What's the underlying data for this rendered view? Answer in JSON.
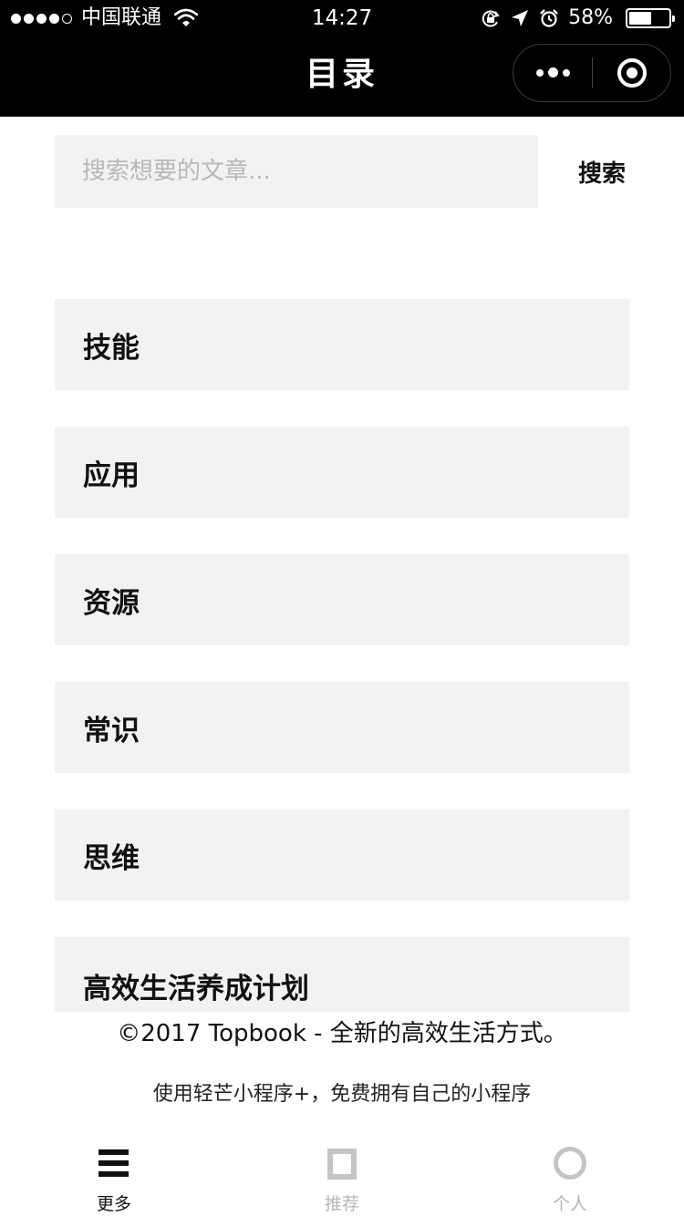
{
  "status_bar": {
    "carrier": "中国联通",
    "time": "14:27",
    "battery": "58%",
    "battery_level": 0.58,
    "icons": [
      "signal-dots-icon",
      "wifi-icon",
      "rotation-lock-icon",
      "location-arrow-icon",
      "alarm-icon",
      "battery-icon"
    ]
  },
  "nav": {
    "title": "目录",
    "capsule_icons": [
      "more-dots-icon",
      "close-target-icon"
    ]
  },
  "search": {
    "placeholder": "搜索想要的文章...",
    "value": "",
    "button_label": "搜索"
  },
  "categories": [
    {
      "label": "技能"
    },
    {
      "label": "应用"
    },
    {
      "label": "资源"
    },
    {
      "label": "常识"
    },
    {
      "label": "思维"
    },
    {
      "label": "高效生活养成计划"
    }
  ],
  "footer": {
    "copyright": "©2017 Topbook - 全新的高效生活方式。",
    "promo": "使用轻芒小程序+，免费拥有自己的小程序"
  },
  "tabbar": {
    "tabs": [
      {
        "label": "更多",
        "icon": "hamburger-icon",
        "active": true
      },
      {
        "label": "推荐",
        "icon": "square-icon",
        "active": false
      },
      {
        "label": "个人",
        "icon": "circle-icon",
        "active": false
      }
    ],
    "active_color": "#111111",
    "inactive_color": "#b5b5b5"
  }
}
